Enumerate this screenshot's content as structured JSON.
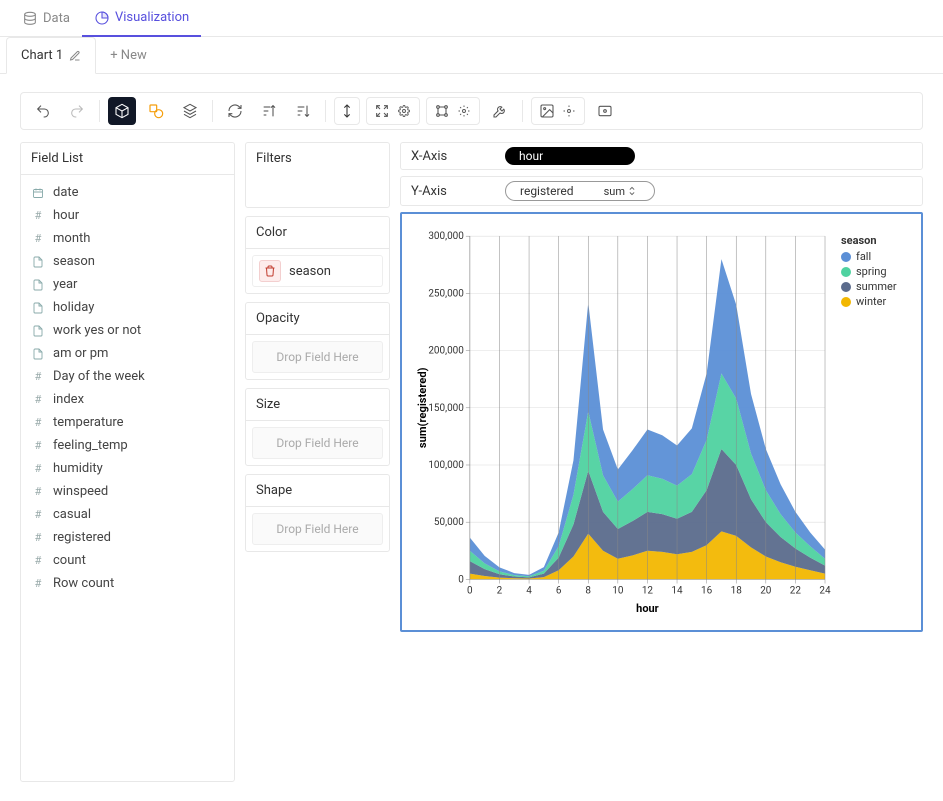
{
  "top_tabs": {
    "data": "Data",
    "visualization": "Visualization"
  },
  "chart_tabs": {
    "chart1": "Chart 1",
    "new": "+ New"
  },
  "panels": {
    "field_list": "Field List",
    "filters": "Filters",
    "color": "Color",
    "opacity": "Opacity",
    "size": "Size",
    "shape": "Shape",
    "drop_hint": "Drop Field Here"
  },
  "encodings": {
    "color_field": "season"
  },
  "axes": {
    "x_label": "X-Axis",
    "y_label": "Y-Axis",
    "x_field": "hour",
    "y_field": "registered",
    "y_agg": "sum"
  },
  "fields": [
    {
      "name": "date",
      "type": "cal"
    },
    {
      "name": "hour",
      "type": "hash"
    },
    {
      "name": "month",
      "type": "hash"
    },
    {
      "name": "season",
      "type": "doc"
    },
    {
      "name": "year",
      "type": "doc"
    },
    {
      "name": "holiday",
      "type": "doc"
    },
    {
      "name": "work yes or not",
      "type": "doc"
    },
    {
      "name": "am or pm",
      "type": "doc"
    },
    {
      "name": "Day of the week",
      "type": "hash"
    },
    {
      "name": "index",
      "type": "hash"
    },
    {
      "name": "temperature",
      "type": "hash"
    },
    {
      "name": "feeling_temp",
      "type": "hash"
    },
    {
      "name": "humidity",
      "type": "hash"
    },
    {
      "name": "winspeed",
      "type": "hash"
    },
    {
      "name": "casual",
      "type": "hash"
    },
    {
      "name": "registered",
      "type": "hash"
    },
    {
      "name": "count",
      "type": "hash"
    },
    {
      "name": "Row count",
      "type": "hash"
    }
  ],
  "chart_data": {
    "type": "area",
    "stacked": true,
    "xlabel": "hour",
    "ylabel": "sum(registered)",
    "x": [
      0,
      1,
      2,
      3,
      4,
      5,
      6,
      7,
      8,
      9,
      10,
      11,
      12,
      13,
      14,
      15,
      16,
      17,
      18,
      19,
      20,
      21,
      22,
      23,
      24
    ],
    "ylim": [
      0,
      300000
    ],
    "yticks": [
      0,
      50000,
      100000,
      150000,
      200000,
      250000,
      300000
    ],
    "xticks": [
      0,
      2,
      4,
      6,
      8,
      10,
      12,
      14,
      16,
      18,
      20,
      22,
      24
    ],
    "legend_title": "season",
    "series": [
      {
        "name": "winter",
        "color": "#f2b701",
        "values": [
          5000,
          3000,
          1500,
          1000,
          800,
          2000,
          8000,
          20000,
          40000,
          25000,
          18000,
          21000,
          25000,
          24000,
          22000,
          24000,
          30000,
          42000,
          38000,
          28000,
          20000,
          15000,
          11000,
          8000,
          5000
        ]
      },
      {
        "name": "summer",
        "color": "#5b6b8c",
        "values": [
          11000,
          6000,
          3000,
          1500,
          1000,
          3000,
          11000,
          28000,
          55000,
          34000,
          26000,
          30000,
          34000,
          33000,
          31000,
          35000,
          48000,
          72000,
          62000,
          42000,
          30000,
          22000,
          16000,
          11000,
          7000
        ]
      },
      {
        "name": "spring",
        "color": "#4fd2a0",
        "values": [
          9000,
          5000,
          2500,
          1200,
          900,
          2500,
          10000,
          26000,
          52000,
          32000,
          24000,
          28000,
          32000,
          31000,
          29000,
          33000,
          44000,
          66000,
          58000,
          40000,
          28000,
          20000,
          14000,
          10000,
          6000
        ]
      },
      {
        "name": "fall",
        "color": "#5b8fd6",
        "values": [
          11500,
          6500,
          3500,
          1800,
          1200,
          3200,
          12000,
          30000,
          95000,
          40000,
          28000,
          34000,
          40000,
          38000,
          35000,
          40000,
          58000,
          100000,
          82000,
          52000,
          36000,
          26000,
          18000,
          12000,
          8000
        ]
      }
    ]
  }
}
